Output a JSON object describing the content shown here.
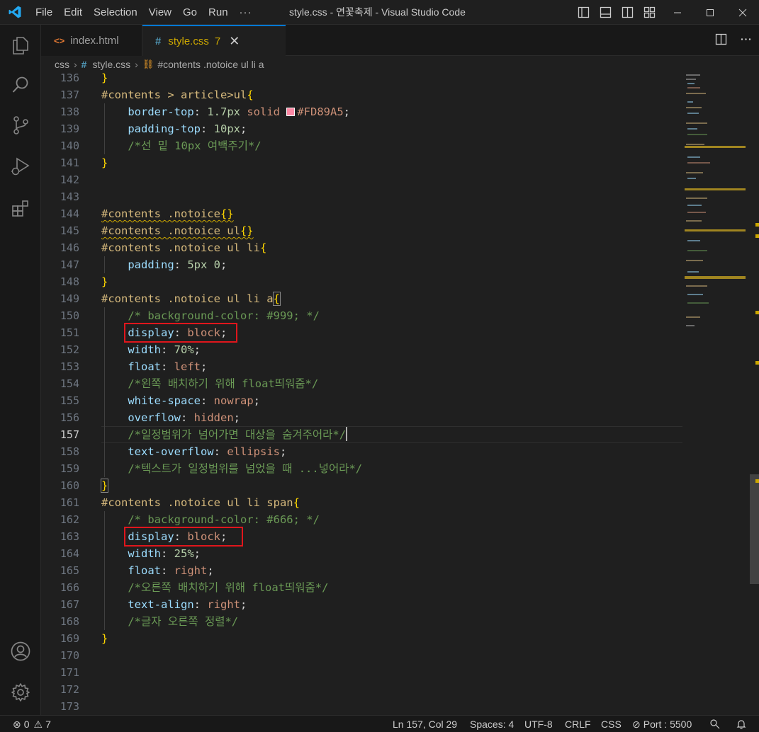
{
  "titlebar": {
    "menu": [
      "File",
      "Edit",
      "Selection",
      "View",
      "Go",
      "Run",
      "···"
    ],
    "title": "style.css - 연꽃축제 - Visual Studio Code"
  },
  "tabs": [
    {
      "label": "index.html",
      "icon": "html-file-icon",
      "active": false
    },
    {
      "label": "style.css",
      "icon": "css-file-icon",
      "active": true,
      "problems": "7",
      "close": "✕"
    }
  ],
  "breadcrumb": {
    "folder": "css",
    "file": "style.css",
    "symbol": "#contents .notoice ul li a"
  },
  "editor": {
    "line_numbers": [
      "136",
      "137",
      "138",
      "139",
      "140",
      "141",
      "142",
      "143",
      "144",
      "145",
      "146",
      "147",
      "148",
      "149",
      "150",
      "151",
      "152",
      "153",
      "154",
      "155",
      "156",
      "157",
      "158",
      "159",
      "160",
      "161",
      "162",
      "163",
      "164",
      "165",
      "166",
      "167",
      "168",
      "169",
      "170",
      "171",
      "172",
      "173"
    ],
    "active_line": "157",
    "code": {
      "l136": "}",
      "l137_sel": "#contents > article>ul",
      "l137_brace": "{",
      "l138_prop": "border-top",
      "l138_colon": ": ",
      "l138_num": "1.7px",
      "l138_val": " solid ",
      "l138_color": "#FD89A5",
      "l138_semi": ";",
      "l139_prop": "padding-top",
      "l139_colon": ": ",
      "l139_num": "10px",
      "l139_semi": ";",
      "l140_cmt": "/*선 밑 10px 여백주기*/",
      "l141": "}",
      "l144_sel": "#contents .notoice",
      "l144_brace": "{}",
      "l145_sel": "#contents .notoice ul",
      "l145_brace": "{}",
      "l146_sel": "#contents .notoice ul li",
      "l146_brace": "{",
      "l147_prop": "padding",
      "l147_colon": ": ",
      "l147_num": "5px 0",
      "l147_semi": ";",
      "l148": "}",
      "l149_sel": "#contents .notoice ul li a",
      "l149_brace": "{",
      "l150_cmt": "/* background-color: #999; */",
      "l151_prop": "display",
      "l151_colon": ": ",
      "l151_val": "block",
      "l151_semi": ";",
      "l152_prop": "width",
      "l152_colon": ": ",
      "l152_num": "70%",
      "l152_semi": ";",
      "l153_prop": "float",
      "l153_colon": ": ",
      "l153_val": "left",
      "l153_semi": ";",
      "l154_cmt": "/*왼쪽 배치하기 위해 float띄워줌*/",
      "l155_prop": "white-space",
      "l155_colon": ": ",
      "l155_val": "nowrap",
      "l155_semi": ";",
      "l156_prop": "overflow",
      "l156_colon": ": ",
      "l156_val": "hidden",
      "l156_semi": ";",
      "l157_cmt": "/*일정범위가 넘어가면 대상을 숨겨주어라*/",
      "l158_prop": "text-overflow",
      "l158_colon": ": ",
      "l158_val": "ellipsis",
      "l158_semi": ";",
      "l159_cmt": "/*텍스트가 일정범위를 넘었을 때 ...넣어라*/",
      "l160": "}",
      "l161_sel": "#contents .notoice ul li span",
      "l161_brace": "{",
      "l162_cmt": "/* background-color: #666; */",
      "l163_prop": "display",
      "l163_colon": ": ",
      "l163_val": "block",
      "l163_semi": ";",
      "l164_prop": "width",
      "l164_colon": ": ",
      "l164_num": "25%",
      "l164_semi": ";",
      "l165_prop": "float",
      "l165_colon": ": ",
      "l165_val": "right",
      "l165_semi": ";",
      "l166_cmt": "/*오른쪽 배치하기 위해 float띄워줌*/",
      "l167_prop": "text-align",
      "l167_colon": ": ",
      "l167_val": "right",
      "l167_semi": ";",
      "l168_cmt": "/*글자 오른쪽 정렬*/",
      "l169": "}"
    },
    "swatch_color": "#FD89A5"
  },
  "statusbar": {
    "errors": "0",
    "warnings": "7",
    "position": "Ln 157, Col 29",
    "spaces": "Spaces: 4",
    "encoding": "UTF-8",
    "eol": "CRLF",
    "language": "CSS",
    "port": "Port : 5500"
  },
  "colors": {
    "accent": "#0078d4",
    "highlight_box": "#e0161c",
    "warning": "#cca700"
  }
}
